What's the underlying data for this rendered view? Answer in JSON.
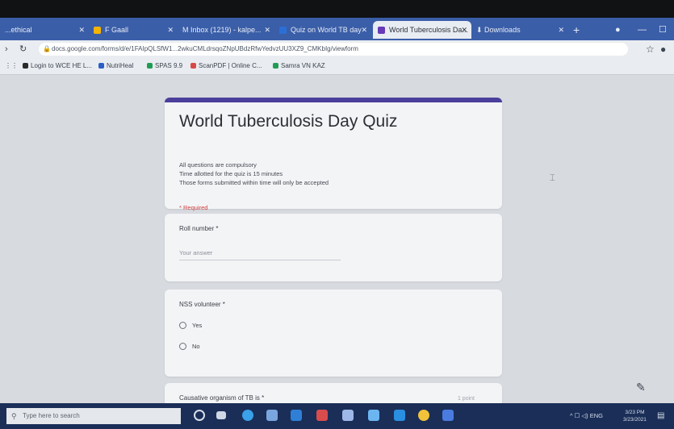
{
  "browser": {
    "tabs": [
      {
        "label": "...ethical",
        "active": false
      },
      {
        "label": "F Gaall",
        "active": false
      },
      {
        "label": "M Inbox (1219) - kalpe...",
        "active": false
      },
      {
        "label": "Quiz on World TB day",
        "active": false
      },
      {
        "label": "World Tuberculosis Da...",
        "active": true
      },
      {
        "label": "Downloads",
        "active": false
      }
    ],
    "address": "docs.google.com/forms/d/e/1FAIpQLSfW1...2wkuCMLdrsqoZNpUBdzRfwYedvzUU3XZ9_CMKbIg/viewform",
    "bookmarks": [
      "Login to WCE HE L...",
      "NutriHeal",
      "SPAS 9.9",
      "ScanPDF | Online C...",
      "Samra VN KAZ"
    ]
  },
  "form": {
    "title": "World Tuberculosis Day Quiz",
    "description": [
      "All questions are compulsory",
      "Time allotted for the quiz is 15 minutes",
      "Those forms submitted within time will only be accepted"
    ],
    "required_note": "* Required",
    "q1": {
      "label": "Roll number *",
      "placeholder": "Your answer"
    },
    "q2": {
      "label": "NSS volunteer *",
      "options": [
        "Yes",
        "No"
      ]
    },
    "q3": {
      "label": "Causative organism of TB is *",
      "extra": "1 point"
    }
  },
  "taskbar": {
    "search_placeholder": "Type here to search",
    "tray_text": "^ ☐ ◁) ENG",
    "time": "3/23 PM",
    "date": "3/23/2021"
  },
  "colors": {
    "form_accent": "#4b3f9c",
    "tabbar": "#3b5ea8",
    "taskbar": "#1a2e58"
  }
}
